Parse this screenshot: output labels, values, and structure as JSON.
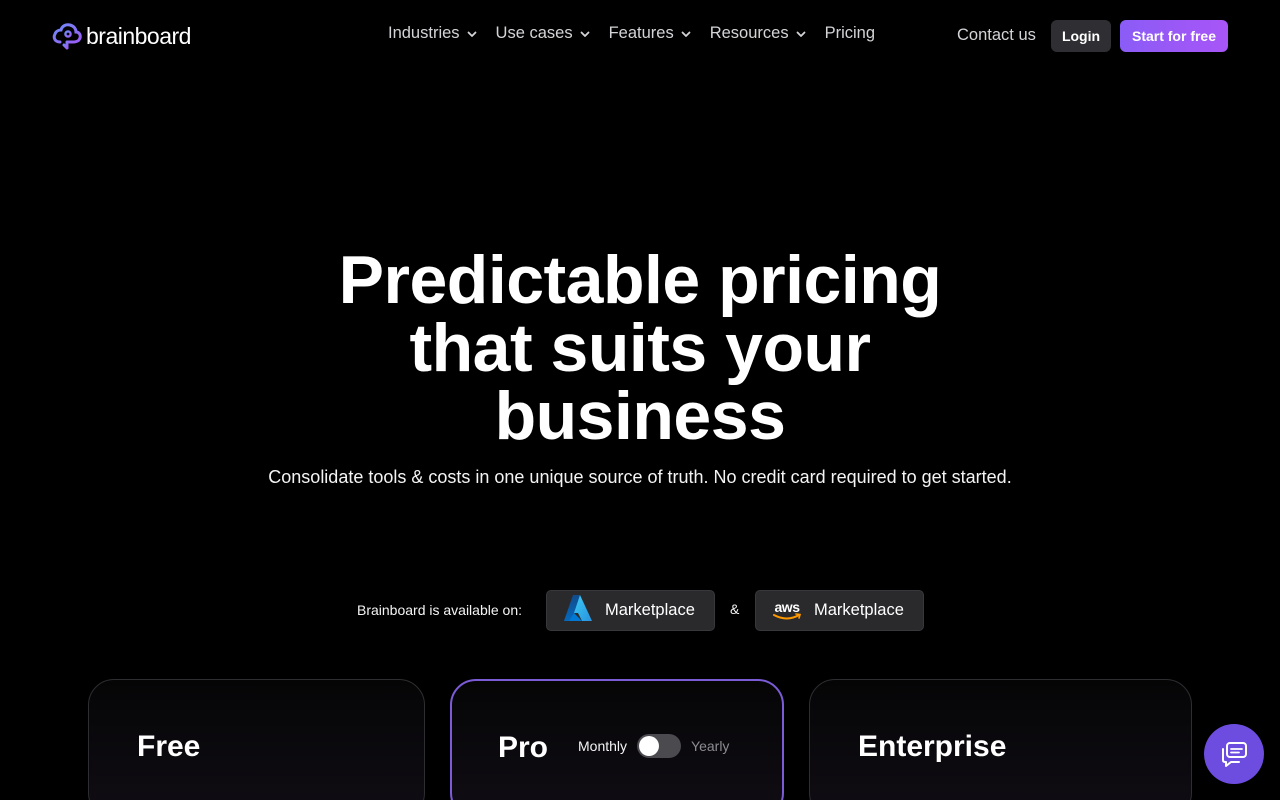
{
  "brand": {
    "name": "brainboard",
    "accent": "#8b5cf6"
  },
  "nav": {
    "items": [
      {
        "label": "Industries",
        "dropdown": true
      },
      {
        "label": "Use cases",
        "dropdown": true
      },
      {
        "label": "Features",
        "dropdown": true
      },
      {
        "label": "Resources",
        "dropdown": true
      },
      {
        "label": "Pricing",
        "dropdown": false
      }
    ],
    "contact": "Contact us",
    "login": "Login",
    "start": "Start for free"
  },
  "hero": {
    "title_lines": [
      "Predictable pricing",
      "that suits your",
      "business"
    ],
    "subtitle": "Consolidate tools & costs in one unique source of truth. No credit card required to get started."
  },
  "marketplace": {
    "available_on": "Brainboard is available on:",
    "azure_label": "Marketplace",
    "separator": "&",
    "aws_text": "aws",
    "aws_label": "Marketplace"
  },
  "plans": {
    "free": {
      "title": "Free"
    },
    "pro": {
      "title": "Pro",
      "billing_monthly": "Monthly",
      "billing_yearly": "Yearly",
      "yearly_selected": false
    },
    "enterprise": {
      "title": "Enterprise"
    }
  },
  "icons": {
    "logo": "brainboard-cloud-icon",
    "chevron": "chevron-down-icon",
    "azure": "azure-logo-icon",
    "aws": "aws-logo-icon",
    "chat": "chat-icon"
  }
}
